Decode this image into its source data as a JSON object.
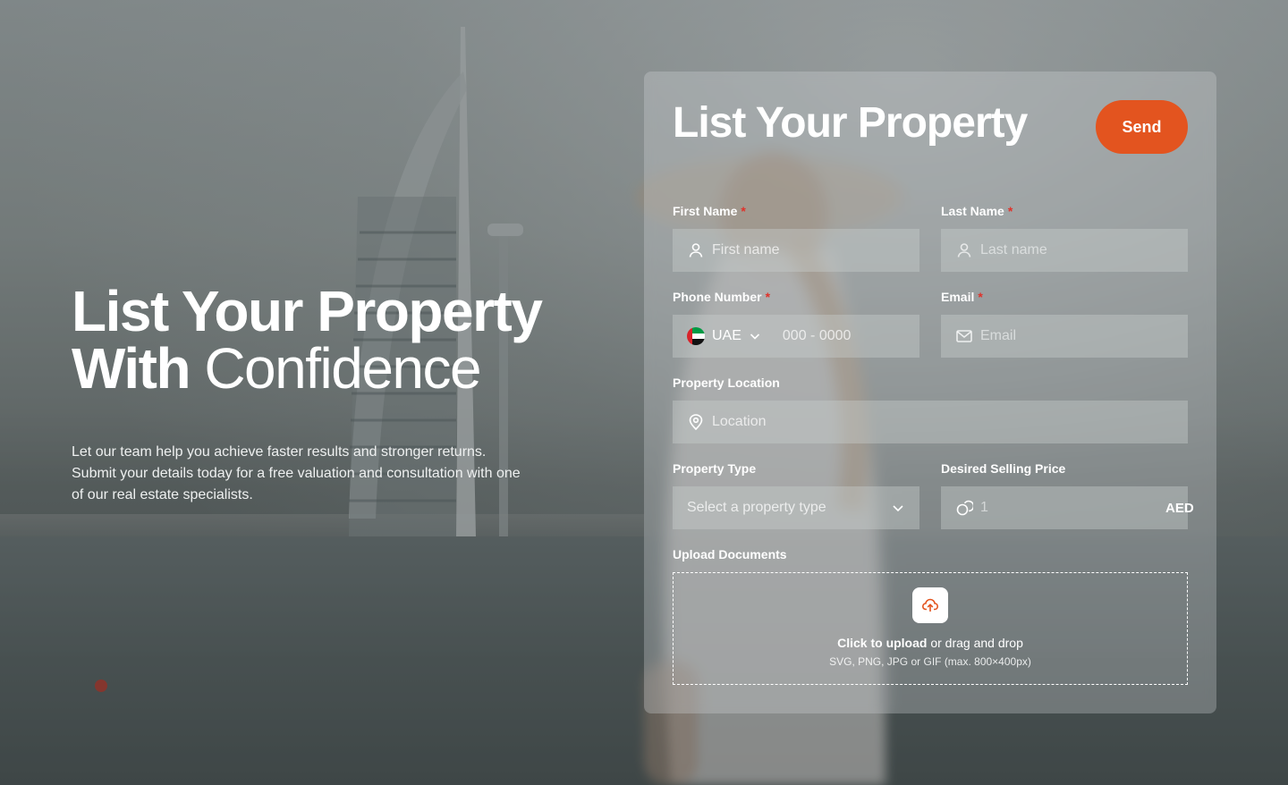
{
  "hero": {
    "title_line1": "List Your Property",
    "title_line2_bold": "With",
    "title_line2_light": "Confidence",
    "description": "Let our team help you achieve faster results and stronger returns. Submit your details today for a free valuation and consultation with one of our real estate specialists."
  },
  "form": {
    "title": "List Your Property",
    "send_label": "Send",
    "first_name": {
      "label": "First Name",
      "required_mark": "*",
      "placeholder": "First name",
      "icon": "user-icon"
    },
    "last_name": {
      "label": "Last Name",
      "required_mark": "*",
      "placeholder": "Last name",
      "icon": "user-icon"
    },
    "phone": {
      "label": "Phone Number",
      "required_mark": "*",
      "country": "UAE",
      "placeholder": "000 - 0000",
      "icon": "uae-flag-icon"
    },
    "email": {
      "label": "Email",
      "required_mark": "*",
      "placeholder": "Email",
      "icon": "mail-icon"
    },
    "location": {
      "label": "Property Location",
      "placeholder": "Location",
      "icon": "map-pin-icon"
    },
    "property_type": {
      "label": "Property Type",
      "placeholder": "Select a property type",
      "icon": "chevron-down-icon"
    },
    "price": {
      "label": "Desired Selling Price",
      "placeholder": "1",
      "currency": "AED",
      "icon": "coins-icon"
    },
    "upload": {
      "label": "Upload Documents",
      "action_text": "Click to upload",
      "rest_text": "or drag and drop",
      "hint": "SVG, PNG, JPG or GIF (max. 800×400px)",
      "icon": "upload-cloud-icon"
    }
  },
  "colors": {
    "accent": "#e3541f",
    "required": "#e0322a",
    "text": "#ffffff"
  }
}
